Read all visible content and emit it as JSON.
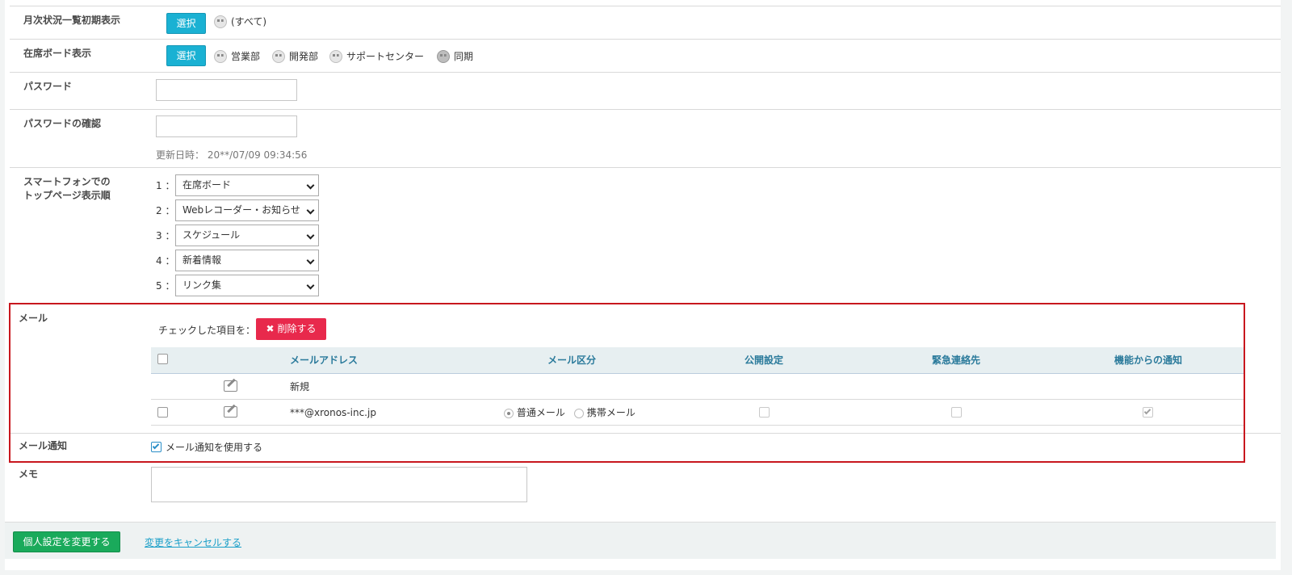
{
  "monthly_status": {
    "label": "月次状況一覧初期表示",
    "select_label": "選択",
    "groups": [
      "(すべて)"
    ]
  },
  "presence_board": {
    "label": "在席ボード表示",
    "select_label": "選択",
    "groups": [
      "営業部",
      "開発部",
      "サポートセンター",
      "同期"
    ]
  },
  "password": {
    "label": "パスワード",
    "value": ""
  },
  "password_confirm": {
    "label": "パスワードの確認",
    "value": "",
    "updated": "更新日時： 20**/07/09 09:34:56"
  },
  "smartphone": {
    "label_line1": "スマートフォンでの",
    "label_line2": "トップページ表示順",
    "orders": [
      {
        "num": "1 ：",
        "value": "在席ボード"
      },
      {
        "num": "2 ：",
        "value": "Webレコーダー・お知らせ"
      },
      {
        "num": "3 ：",
        "value": "スケジュール"
      },
      {
        "num": "4 ：",
        "value": "新着情報"
      },
      {
        "num": "5 ：",
        "value": "リンク集"
      }
    ]
  },
  "mail": {
    "label": "メール",
    "checked_action_text": "チェックした項目を：",
    "delete_label": "削除する",
    "columns": {
      "address": "メールアドレス",
      "type": "メール区分",
      "public": "公開設定",
      "emergency": "緊急連絡先",
      "notify": "機能からの通知"
    },
    "new_row_label": "新規",
    "rows": [
      {
        "address": "***@xronos-inc.jp",
        "type_normal": "普通メール",
        "type_mobile": "携帯メール",
        "selected_type": "普通メール",
        "public": false,
        "emergency": false,
        "notify": true
      }
    ]
  },
  "mail_notify": {
    "label": "メール通知",
    "checkbox_label": "メール通知を使用する",
    "checked": true
  },
  "memo": {
    "label": "メモ",
    "value": ""
  },
  "footer": {
    "save_label": "個人設定を変更する",
    "cancel_label": "変更をキャンセルする"
  },
  "colors": {
    "select_button": "#1ab1d3",
    "delete_button": "#e8294c",
    "save_button": "#1aaa5b",
    "highlight_frame": "#c8171e",
    "table_header_text": "#2a7a9b"
  }
}
